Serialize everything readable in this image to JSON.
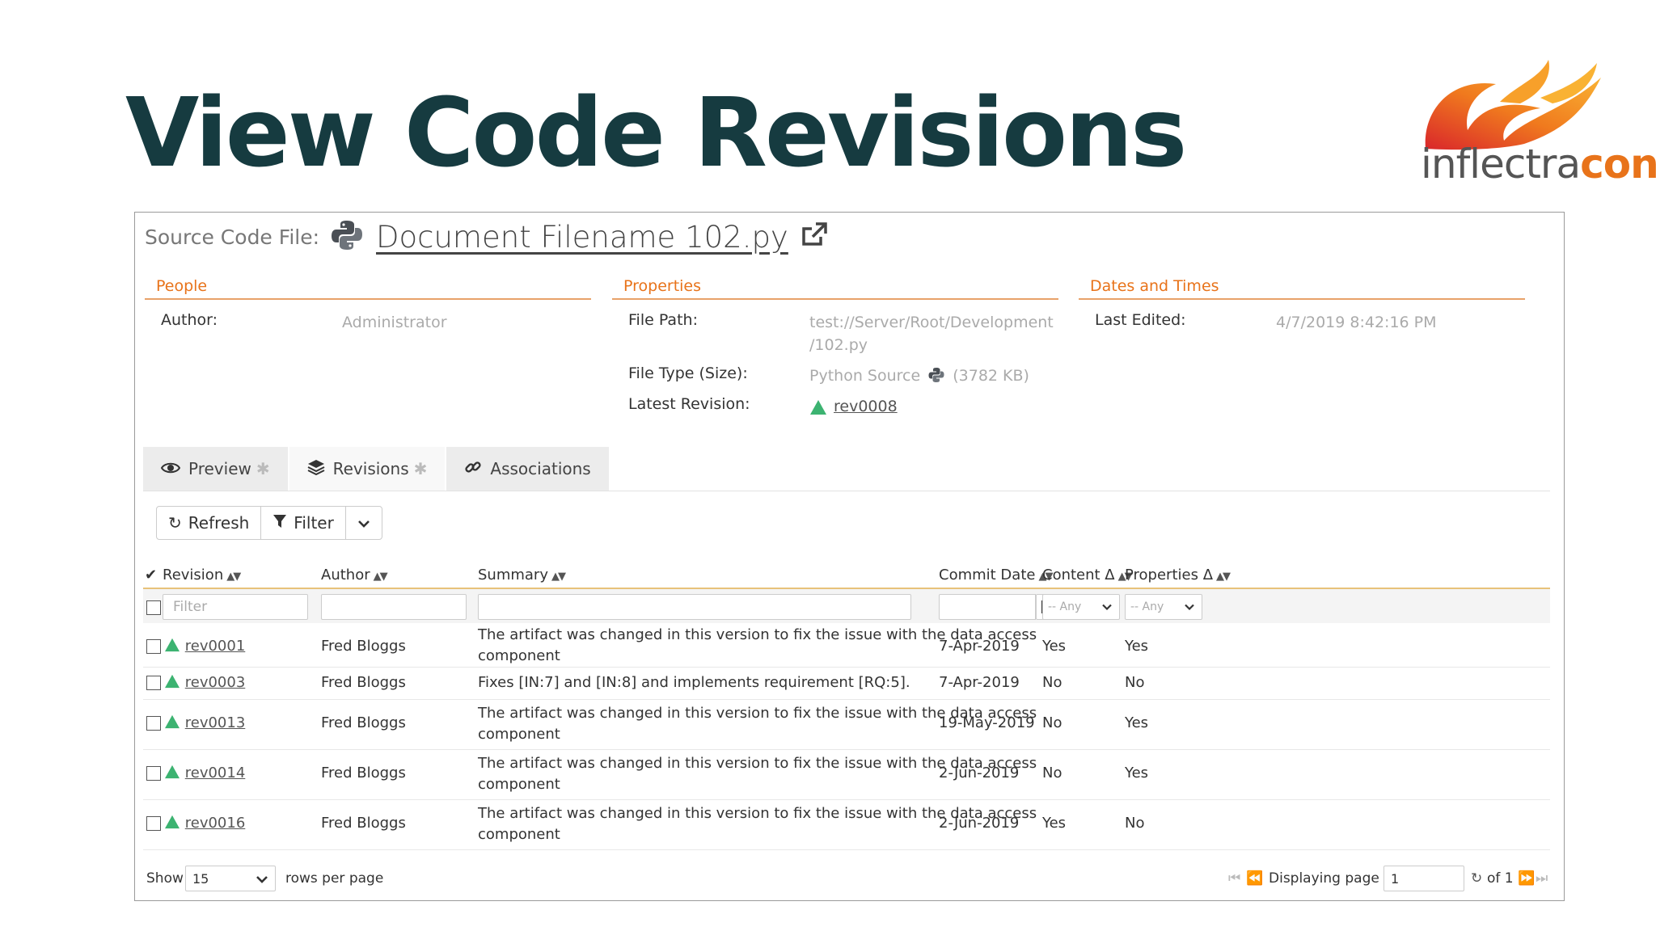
{
  "slide": {
    "title": "View Code Revisions",
    "logo": {
      "text_a": "inflectra",
      "text_b": "con"
    }
  },
  "file": {
    "label": "Source Code File:",
    "name": "Document Filename 102.py"
  },
  "sections": {
    "people": {
      "title": "People",
      "author_label": "Author:",
      "author_value": "Administrator"
    },
    "properties": {
      "title": "Properties",
      "path_label": "File Path:",
      "path_line1": "test://Server/Root/Development",
      "path_line2": "/102.py",
      "type_label": "File Type (Size):",
      "type_value": "Python Source",
      "type_size": "(3782 KB)",
      "latest_label": "Latest Revision:",
      "latest_value": "rev0008"
    },
    "dates": {
      "title": "Dates and Times",
      "edited_label": "Last Edited:",
      "edited_value": "4/7/2019 8:42:16 PM"
    }
  },
  "tabs": [
    {
      "label": "Preview",
      "icon": "eye-icon"
    },
    {
      "label": "Revisions",
      "icon": "layers-icon"
    },
    {
      "label": "Associations",
      "icon": "link-icon"
    }
  ],
  "toolbar": {
    "refresh": "Refresh",
    "filter": "Filter"
  },
  "grid": {
    "columns": {
      "revision": "Revision",
      "author": "Author",
      "summary": "Summary",
      "commit_date": "Commit Date",
      "content": "Content Δ",
      "properties": "Properties Δ"
    },
    "filter": {
      "placeholder": "Filter",
      "any1": "-- Any",
      "any2": "-- Any"
    },
    "rows": [
      {
        "rev": "rev0001",
        "author": "Fred Bloggs",
        "summary": "The artifact was changed in this version to fix the issue with the data access component",
        "date": "7-Apr-2019",
        "content": "Yes",
        "properties": "Yes"
      },
      {
        "rev": "rev0003",
        "author": "Fred Bloggs",
        "summary": "Fixes [IN:7] and [IN:8] and implements requirement [RQ:5].",
        "date": "7-Apr-2019",
        "content": "No",
        "properties": "No"
      },
      {
        "rev": "rev0013",
        "author": "Fred Bloggs",
        "summary": "The artifact was changed in this version to fix the issue with the data access component",
        "date": "19-May-2019",
        "content": "No",
        "properties": "Yes"
      },
      {
        "rev": "rev0014",
        "author": "Fred Bloggs",
        "summary": "The artifact was changed in this version to fix the issue with the data access component",
        "date": "2-Jun-2019",
        "content": "No",
        "properties": "Yes"
      },
      {
        "rev": "rev0016",
        "author": "Fred Bloggs",
        "summary": "The artifact was changed in this version to fix the issue with the data access component",
        "date": "2-Jun-2019",
        "content": "Yes",
        "properties": "No"
      }
    ]
  },
  "footer": {
    "show": "Show",
    "rows_value": "15",
    "rows_per_page": "rows per page",
    "displaying": "Displaying page",
    "page_value": "1",
    "of": "of 1"
  }
}
